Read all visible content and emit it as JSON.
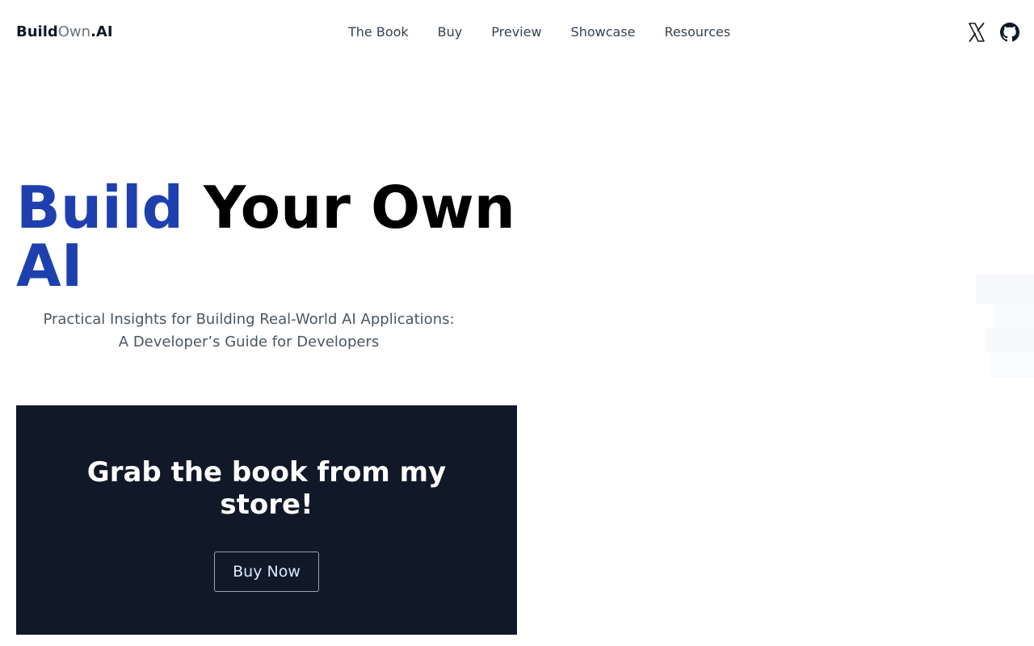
{
  "nav": {
    "logo": {
      "part1": "Build",
      "part2": "Own",
      "part3": ".AI"
    },
    "links": [
      "The Book",
      "Buy",
      "Preview",
      "Showcase",
      "Resources"
    ],
    "social": [
      {
        "icon": "x-twitter-icon",
        "label": "X"
      },
      {
        "icon": "github-icon",
        "label": "GitHub"
      }
    ]
  },
  "hero": {
    "title_highlight_1": "Build",
    "title_mid": "Your Own",
    "title_highlight_2": "AI",
    "subtitle_line1": "Practical Insights for Building Real-World AI Applications:",
    "subtitle_line2": "A Developer’s Guide for Developers"
  },
  "store": {
    "heading": "Grab the book from my store!",
    "button_label": "Buy Now"
  },
  "colors": {
    "accent_blue": "#1e40af",
    "store_background": "#111827",
    "button_text": "#dbeafe"
  }
}
